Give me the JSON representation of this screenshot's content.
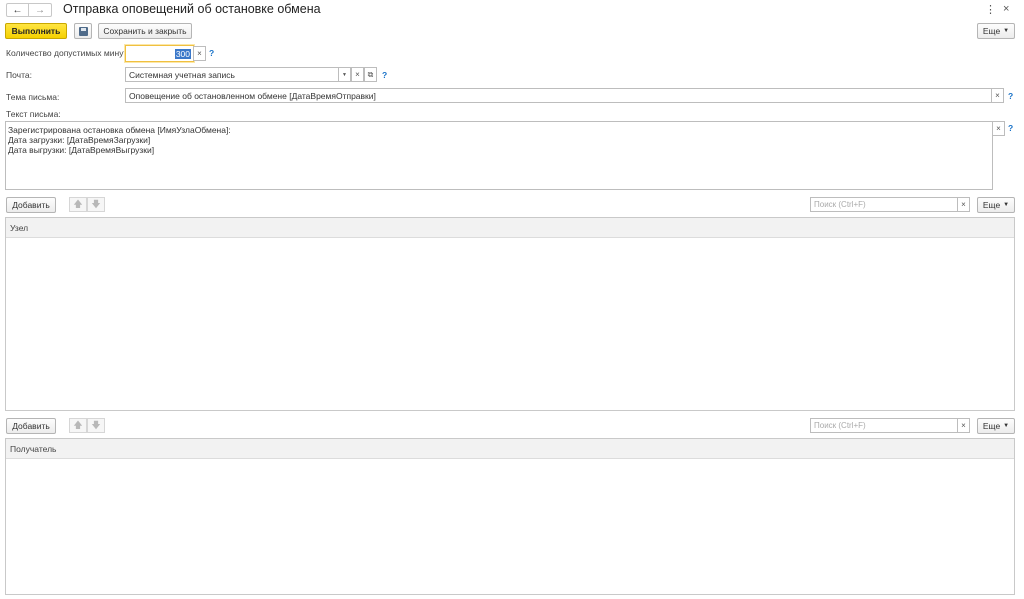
{
  "window": {
    "title": "Отправка оповещений об остановке обмена",
    "menu_glyph": "⋮",
    "close_glyph": "×"
  },
  "nav": {
    "back": "←",
    "forward": "→"
  },
  "toolbar": {
    "execute_label": "Выполнить",
    "save_close_label": "Сохранить и закрыть",
    "more_label": "Еще"
  },
  "form": {
    "minutes": {
      "label": "Количество допустимых минут:",
      "value": "300"
    },
    "mail": {
      "label": "Почта:",
      "value": "Системная учетная запись"
    },
    "subject": {
      "label": "Тема письма:",
      "value": "Оповещение об остановленном обмене [ДатаВремяОтправки]"
    },
    "body": {
      "label": "Текст письма:",
      "lines": [
        "Зарегистрирована остановка обмена [ИмяУзлаОбмена]:",
        "Дата загрузки: [ДатаВремяЗагрузки]",
        "Дата выгрузки: [ДатаВремяВыгрузки]"
      ]
    },
    "help": "?",
    "clear": "×"
  },
  "nodes_table": {
    "add_label": "Добавить",
    "search_placeholder": "Поиск (Ctrl+F)",
    "more_label": "Еще",
    "column": "Узел",
    "up": "🡅",
    "down": "🡇"
  },
  "recipients_table": {
    "add_label": "Добавить",
    "search_placeholder": "Поиск (Ctrl+F)",
    "more_label": "Еще",
    "column": "Получатель",
    "up": "🡅",
    "down": "🡇"
  },
  "colors": {
    "accent_yellow": "#f5d100",
    "help_blue": "#1a73c8",
    "focus_border": "#f0c040"
  }
}
